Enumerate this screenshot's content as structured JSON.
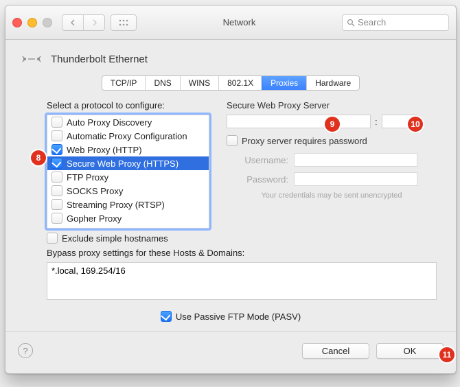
{
  "window": {
    "title": "Network",
    "search_placeholder": "Search"
  },
  "header": {
    "interface": "Thunderbolt Ethernet"
  },
  "tabs": [
    "TCP/IP",
    "DNS",
    "WINS",
    "802.1X",
    "Proxies",
    "Hardware"
  ],
  "left": {
    "label": "Select a protocol to configure:",
    "protocols": [
      {
        "name": "Auto Proxy Discovery",
        "checked": false
      },
      {
        "name": "Automatic Proxy Configuration",
        "checked": false
      },
      {
        "name": "Web Proxy (HTTP)",
        "checked": true
      },
      {
        "name": "Secure Web Proxy (HTTPS)",
        "checked": true,
        "selected": true
      },
      {
        "name": "FTP Proxy",
        "checked": false
      },
      {
        "name": "SOCKS Proxy",
        "checked": false
      },
      {
        "name": "Streaming Proxy (RTSP)",
        "checked": false
      },
      {
        "name": "Gopher Proxy",
        "checked": false
      }
    ],
    "exclude_label": "Exclude simple hostnames",
    "exclude_checked": false
  },
  "right": {
    "server_label": "Secure Web Proxy Server",
    "host": "",
    "port": "",
    "requires_pwd_label": "Proxy server requires password",
    "requires_pwd_checked": false,
    "username_label": "Username:",
    "password_label": "Password:",
    "note": "Your credentials may be sent unencrypted"
  },
  "bypass": {
    "label": "Bypass proxy settings for these Hosts & Domains:",
    "value": "*.local, 169.254/16"
  },
  "passive_ftp_label": "Use Passive FTP Mode (PASV)",
  "passive_ftp_checked": true,
  "footer": {
    "cancel": "Cancel",
    "ok": "OK"
  },
  "annotations": [
    "8",
    "9",
    "10",
    "11"
  ]
}
